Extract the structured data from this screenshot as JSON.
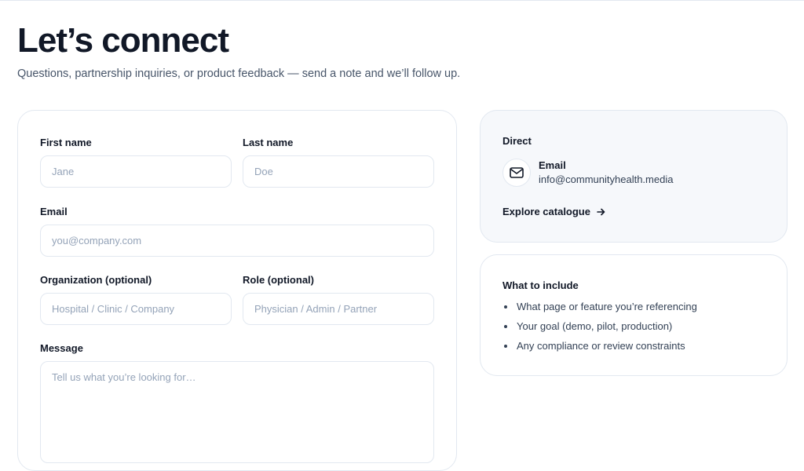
{
  "header": {
    "title": "Let’s connect",
    "subtitle": "Questions, partnership inquiries, or product feedback — send a note and we’ll follow up."
  },
  "form": {
    "first_name": {
      "label": "First name",
      "placeholder": "Jane",
      "value": ""
    },
    "last_name": {
      "label": "Last name",
      "placeholder": "Doe",
      "value": ""
    },
    "email": {
      "label": "Email",
      "placeholder": "you@company.com",
      "value": ""
    },
    "organization": {
      "label": "Organization (optional)",
      "placeholder": "Hospital / Clinic / Company",
      "value": ""
    },
    "role": {
      "label": "Role (optional)",
      "placeholder": "Physician / Admin / Partner",
      "value": ""
    },
    "message": {
      "label": "Message",
      "placeholder": "Tell us what you’re looking for…",
      "value": ""
    }
  },
  "direct": {
    "heading": "Direct",
    "email_icon": "mail-icon",
    "email_label": "Email",
    "email_value": "info@communityhealth.media",
    "explore_label": "Explore catalogue",
    "explore_icon": "arrow-right-icon"
  },
  "include": {
    "heading": "What to include",
    "items": [
      "What page or feature you’re referencing",
      "Your goal (demo, pilot, production)",
      "Any compliance or review constraints"
    ]
  }
}
